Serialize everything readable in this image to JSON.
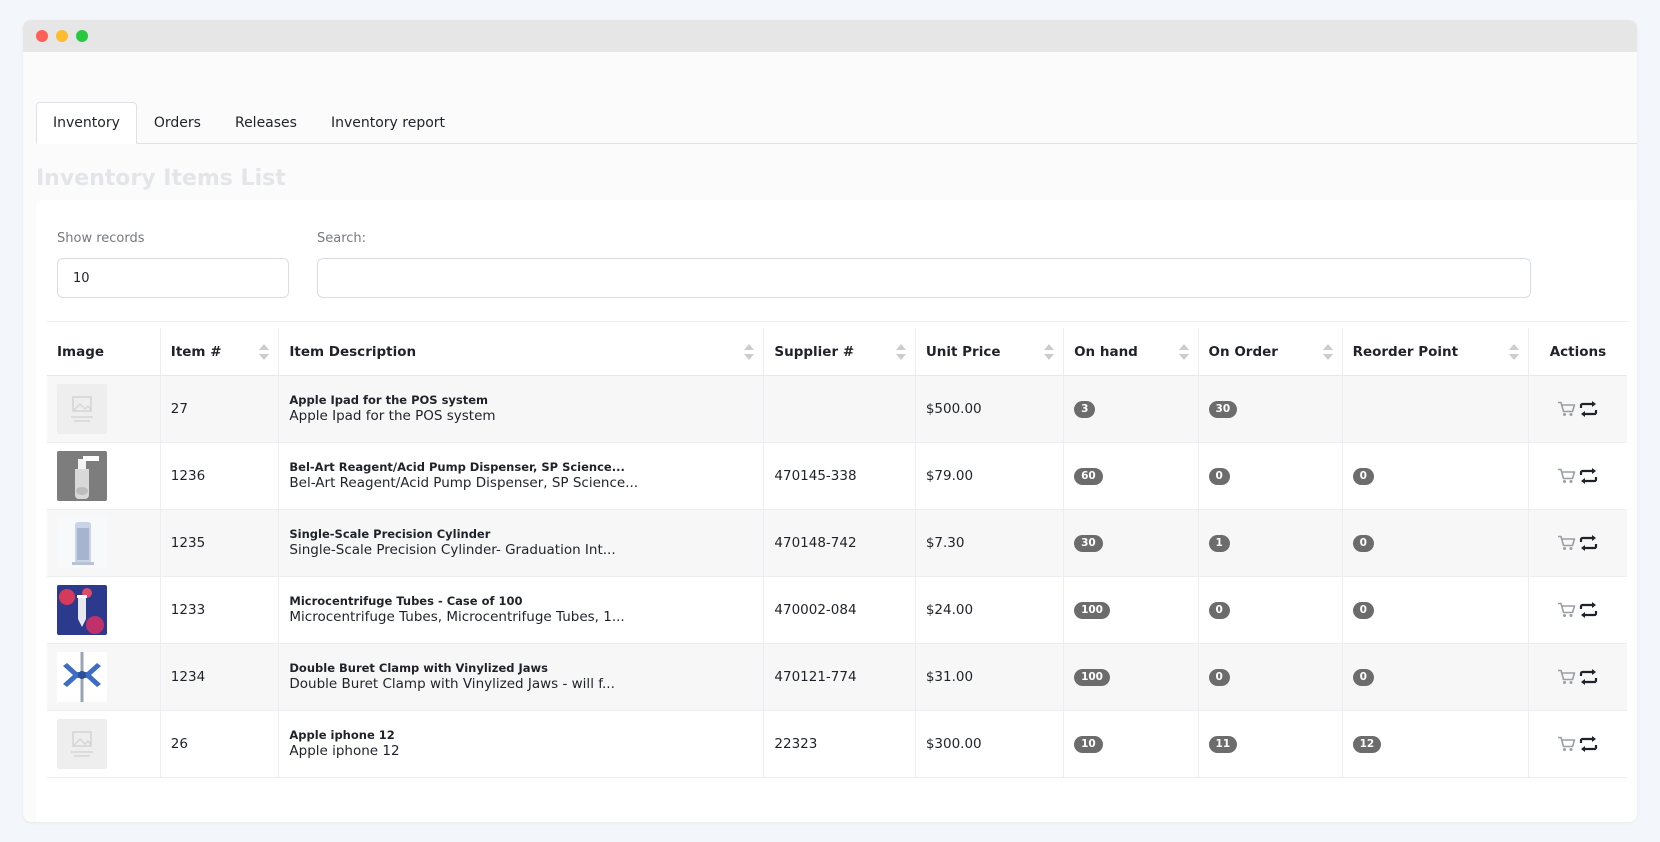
{
  "tabs": [
    {
      "label": "Inventory",
      "active": true
    },
    {
      "label": "Orders"
    },
    {
      "label": "Releases"
    },
    {
      "label": "Inventory report"
    }
  ],
  "page_title": "Inventory Items List",
  "controls": {
    "show_records_label": "Show records",
    "show_records_value": "10",
    "search_label": "Search:",
    "search_value": ""
  },
  "table": {
    "headers": [
      "Image",
      "Item #",
      "Item Description",
      "Supplier #",
      "Unit Price",
      "On hand",
      "On Order",
      "Reorder Point",
      "Actions"
    ],
    "rows": [
      {
        "image": "placeholder",
        "item": "27",
        "title": "Apple Ipad for the POS system",
        "desc": "Apple Ipad for the POS system",
        "supplier": "",
        "price": "$500.00",
        "on_hand": "3",
        "on_order": "30",
        "reorder": ""
      },
      {
        "image": "pump",
        "item": "1236",
        "title": "Bel-Art Reagent/Acid Pump Dispenser, SP Science...",
        "desc": "Bel-Art Reagent/Acid Pump Dispenser, SP Science...",
        "supplier": "470145-338",
        "price": "$79.00",
        "on_hand": "60",
        "on_order": "0",
        "reorder": "0"
      },
      {
        "image": "cylinder",
        "item": "1235",
        "title": "Single-Scale Precision Cylinder",
        "desc": "Single-Scale Precision Cylinder- Graduation Int...",
        "supplier": "470148-742",
        "price": "$7.30",
        "on_hand": "30",
        "on_order": "1",
        "reorder": "0"
      },
      {
        "image": "tubes",
        "item": "1233",
        "title": "Microcentrifuge Tubes - Case of 100",
        "desc": "Microcentrifuge Tubes, Microcentrifuge Tubes, 1...",
        "supplier": "470002-084",
        "price": "$24.00",
        "on_hand": "100",
        "on_order": "0",
        "reorder": "0"
      },
      {
        "image": "clamp",
        "item": "1234",
        "title": "Double Buret Clamp with Vinylized Jaws",
        "desc": "Double Buret Clamp with Vinylized Jaws - will f...",
        "supplier": "470121-774",
        "price": "$31.00",
        "on_hand": "100",
        "on_order": "0",
        "reorder": "0"
      },
      {
        "image": "placeholder",
        "item": "26",
        "title": "Apple iphone 12",
        "desc": "Apple iphone 12",
        "supplier": "22323",
        "price": "$300.00",
        "on_hand": "10",
        "on_order": "11",
        "reorder": "12"
      }
    ]
  },
  "colors": {
    "badge": "#6c6c6c",
    "cart_icon": "#9a9ea5",
    "transfer_icon": "#1f2329"
  }
}
